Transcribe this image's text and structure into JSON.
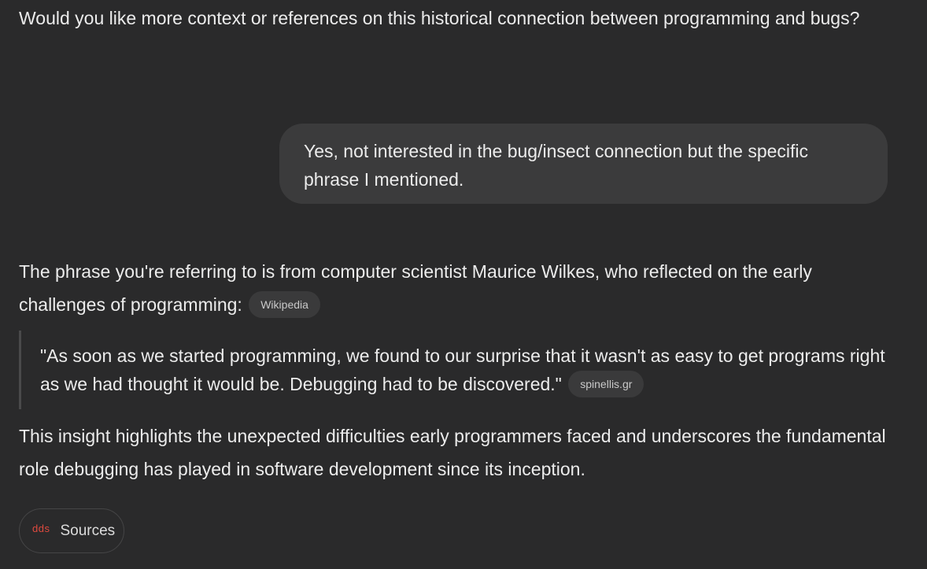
{
  "conversation": {
    "assistant_intro": "Would you like more context or references on this historical connection between programming and bugs?",
    "user_message": "Yes, not interested in the bug/insect connection but the specific phrase I mentioned.",
    "answer_text": "The phrase you're referring to is from computer scientist Maurice Wilkes, who reflected on the early challenges of programming:",
    "answer_citation": "Wikipedia",
    "quote_text": "\"As soon as we started programming, we found to our surprise that it wasn't as easy to get programs right as we had thought it would be. Debugging had to be discovered.\"",
    "quote_citation": "spinellis.gr",
    "insight_text": "This insight highlights the unexpected difficulties early programmers faced and underscores the fundamental role debugging has played in software development since its inception."
  },
  "sources": {
    "icon_text": "dds",
    "icon": "sources-favicon-icon",
    "label": "Sources"
  },
  "colors": {
    "background": "#2a2a2b",
    "user_bubble": "#3b3b3c",
    "chip": "#3a3a3b",
    "text": "#ececec",
    "source_icon": "#e04a3f"
  }
}
